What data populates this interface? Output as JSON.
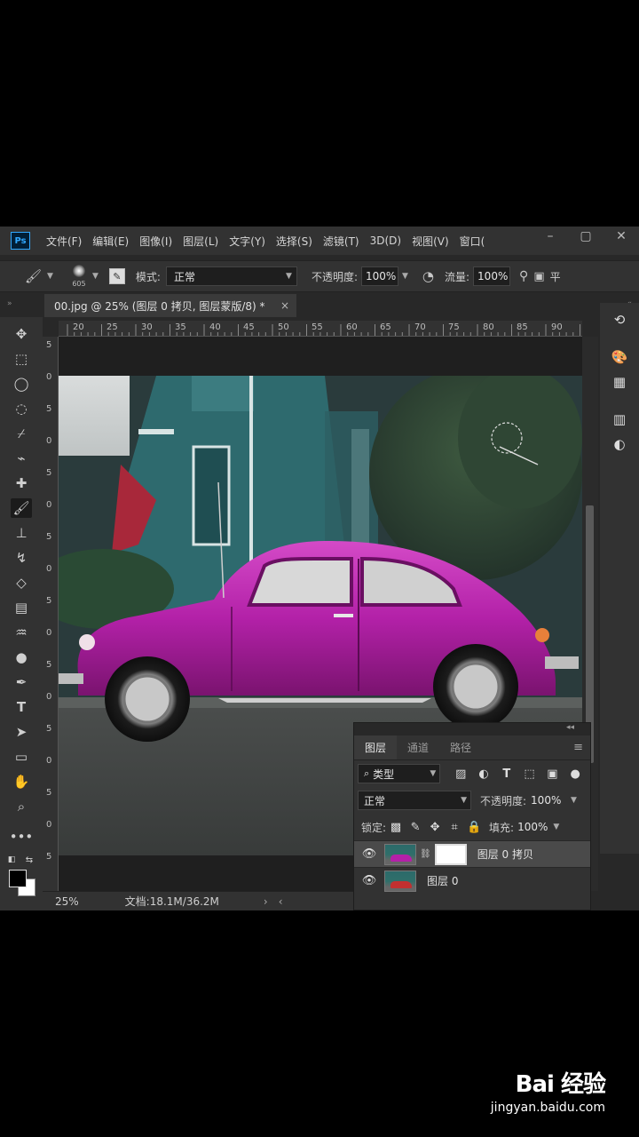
{
  "app": {
    "logo": "Ps",
    "menu": [
      "文件(F)",
      "编辑(E)",
      "图像(I)",
      "图层(L)",
      "文字(Y)",
      "选择(S)",
      "滤镜(T)",
      "3D(D)",
      "视图(V)",
      "窗口("
    ]
  },
  "options": {
    "brush_size": "605",
    "mode_label": "模式:",
    "mode_value": "正常",
    "opacity_label": "不透明度:",
    "opacity_value": "100%",
    "flow_label": "流量:",
    "flow_value": "100%",
    "smooth_label": "平"
  },
  "document": {
    "tab_title": "00.jpg @ 25% (图层 0 拷贝, 图层蒙版/8) *",
    "close": "×"
  },
  "ruler": {
    "h_ticks": [
      "20",
      "25",
      "30",
      "35",
      "40",
      "45",
      "50",
      "55",
      "60",
      "65",
      "70",
      "75",
      "80",
      "85",
      "90"
    ],
    "v_ticks": [
      "5",
      "0",
      "5",
      "0",
      "5",
      "0",
      "5",
      "0",
      "5",
      "0",
      "5",
      "0",
      "5",
      "0",
      "5",
      "0",
      "5"
    ]
  },
  "layers_panel": {
    "tabs": [
      "图层",
      "通道",
      "路径"
    ],
    "filter_label": "类型",
    "blend_mode": "正常",
    "opacity_label": "不透明度:",
    "opacity_value": "100%",
    "lock_label": "锁定:",
    "fill_label": "填充:",
    "fill_value": "100%",
    "layers": [
      {
        "name": "图层 0 拷贝",
        "selected": true
      },
      {
        "name": "图层 0",
        "selected": false
      }
    ]
  },
  "status": {
    "zoom": "25%",
    "doc_size": "文档:18.1M/36.2M"
  },
  "watermark": {
    "logo": "Bai 经验",
    "url": "jingyan.baidu.com"
  },
  "colors": {
    "car": "#b321a8",
    "house": "#2e6a6e",
    "ps_blue": "#31a8ff"
  }
}
